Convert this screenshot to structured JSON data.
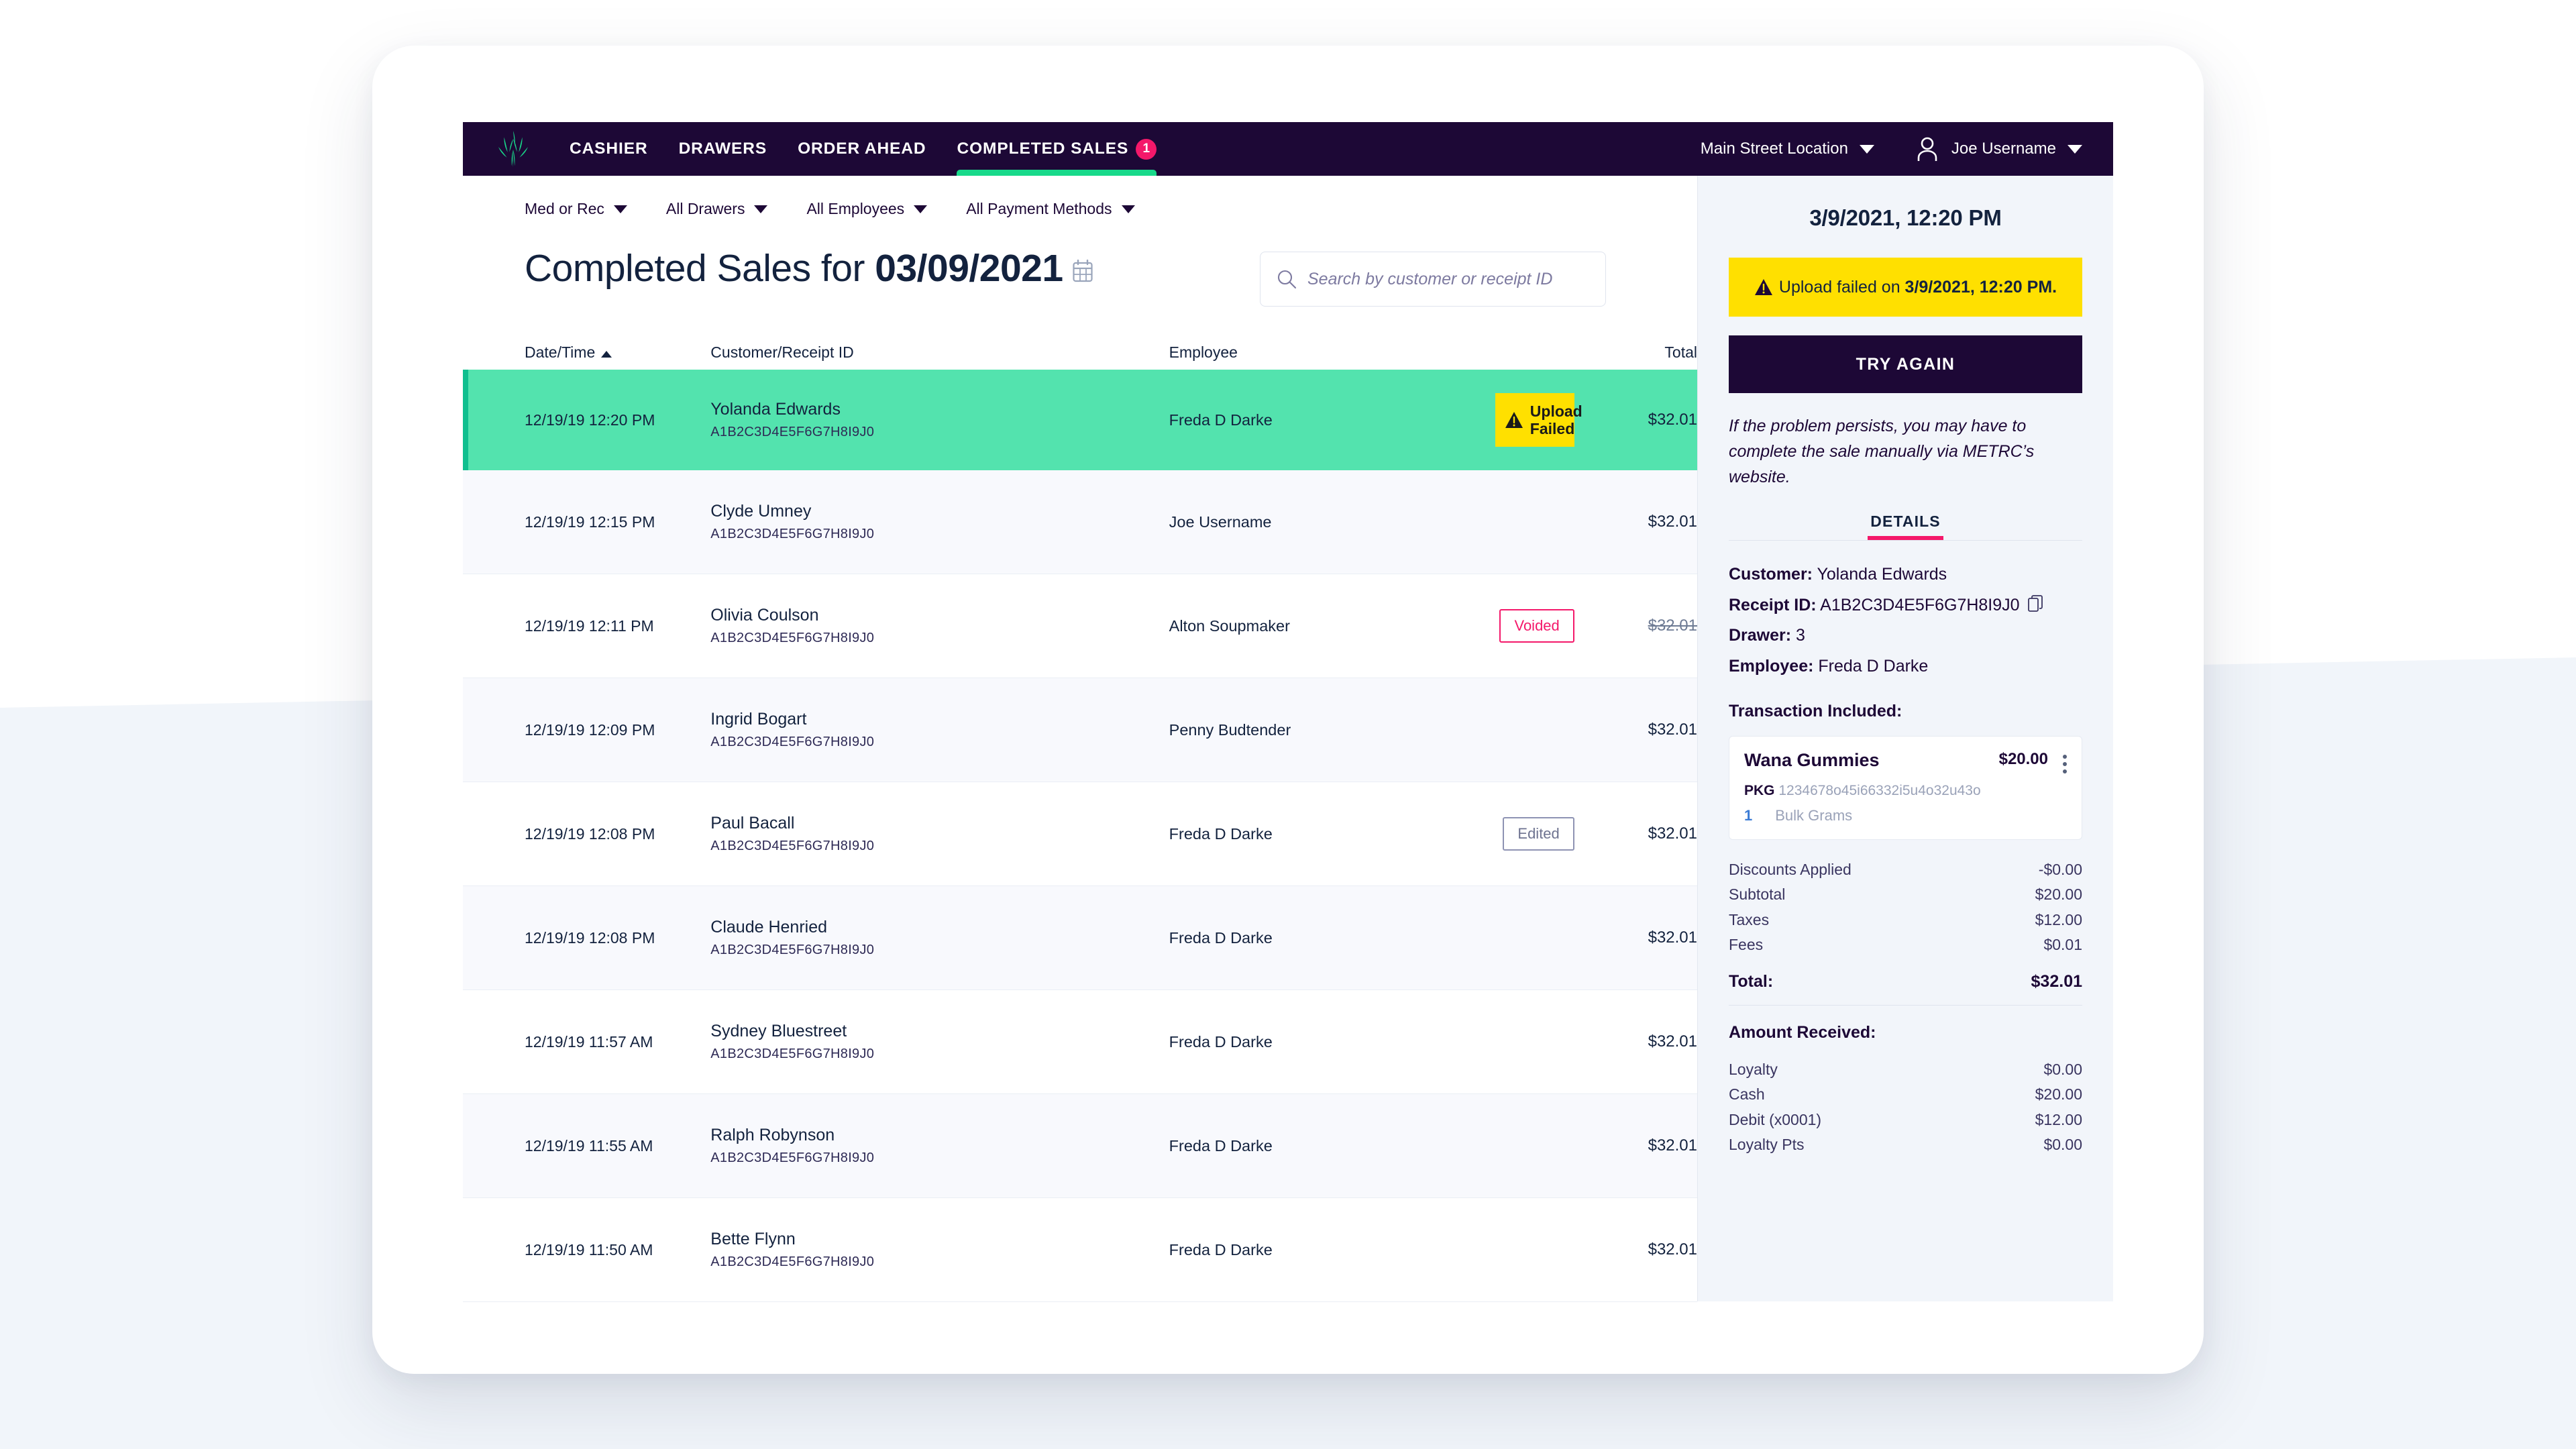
{
  "nav": {
    "logo_icon": "cannabis-leaf-icon",
    "links": [
      {
        "label": "CASHIER",
        "active": false
      },
      {
        "label": "DRAWERS",
        "active": false
      },
      {
        "label": "ORDER AHEAD",
        "active": false
      },
      {
        "label": "COMPLETED SALES",
        "active": true,
        "badge": "1"
      }
    ],
    "location": "Main Street Location",
    "user": "Joe Username"
  },
  "filters": [
    {
      "label": "Med or Rec"
    },
    {
      "label": "All Drawers"
    },
    {
      "label": "All Employees"
    },
    {
      "label": "All Payment Methods"
    }
  ],
  "header": {
    "title_prefix": "Completed Sales for ",
    "title_date": "03/09/2021",
    "calendar_icon": "calendar-icon"
  },
  "search": {
    "placeholder": "Search by customer or receipt ID",
    "value": "",
    "icon": "search-icon"
  },
  "table": {
    "columns": [
      "Date/Time",
      "Customer/Receipt ID",
      "Employee",
      "",
      "Total"
    ],
    "sort_column": "Date/Time",
    "sort_direction": "asc",
    "rows": [
      {
        "datetime": "12/19/19 12:20 PM",
        "customer": "Yolanda Edwards",
        "receipt_id": "A1B2C3D4E5F6G7H8I9J0",
        "employee": "Freda D Darke",
        "flag": "Upload Failed",
        "flag_type": "upload-failed",
        "total": "$32.01",
        "selected": true
      },
      {
        "datetime": "12/19/19 12:15 PM",
        "customer": "Clyde Umney",
        "receipt_id": "A1B2C3D4E5F6G7H8I9J0",
        "employee": "Joe Username",
        "flag": "",
        "flag_type": "",
        "total": "$32.01",
        "selected": false
      },
      {
        "datetime": "12/19/19 12:11 PM",
        "customer": "Olivia Coulson",
        "receipt_id": "A1B2C3D4E5F6G7H8I9J0",
        "employee": "Alton Soupmaker",
        "flag": "Voided",
        "flag_type": "voided",
        "total": "$32.01",
        "selected": false
      },
      {
        "datetime": "12/19/19 12:09 PM",
        "customer": "Ingrid Bogart",
        "receipt_id": "A1B2C3D4E5F6G7H8I9J0",
        "employee": "Penny Budtender",
        "flag": "",
        "flag_type": "",
        "total": "$32.01",
        "selected": false
      },
      {
        "datetime": "12/19/19 12:08 PM",
        "customer": "Paul Bacall",
        "receipt_id": "A1B2C3D4E5F6G7H8I9J0",
        "employee": "Freda D Darke",
        "flag": "Edited",
        "flag_type": "edited",
        "total": "$32.01",
        "selected": false
      },
      {
        "datetime": "12/19/19 12:08 PM",
        "customer": "Claude Henried",
        "receipt_id": "A1B2C3D4E5F6G7H8I9J0",
        "employee": "Freda D Darke",
        "flag": "",
        "flag_type": "",
        "total": "$32.01",
        "selected": false
      },
      {
        "datetime": "12/19/19 11:57 AM",
        "customer": "Sydney Bluestreet",
        "receipt_id": "A1B2C3D4E5F6G7H8I9J0",
        "employee": "Freda D Darke",
        "flag": "",
        "flag_type": "",
        "total": "$32.01",
        "selected": false
      },
      {
        "datetime": "12/19/19 11:55 AM",
        "customer": "Ralph Robynson",
        "receipt_id": "A1B2C3D4E5F6G7H8I9J0",
        "employee": "Freda D Darke",
        "flag": "",
        "flag_type": "",
        "total": "$32.01",
        "selected": false
      },
      {
        "datetime": "12/19/19 11:50 AM",
        "customer": "Bette Flynn",
        "receipt_id": "A1B2C3D4E5F6G7H8I9J0",
        "employee": "Freda D Darke",
        "flag": "",
        "flag_type": "",
        "total": "$32.01",
        "selected": false
      }
    ]
  },
  "detail": {
    "datetime": "3/9/2021, 12:20 PM",
    "alert_icon": "warning-triangle-icon",
    "alert_prefix": "Upload failed on ",
    "alert_date": "3/9/2021, 12:20 PM.",
    "try_again_label": "TRY AGAIN",
    "note": "If the problem persists, you may have to complete the sale manually via METRC’s website.",
    "tab_label": "DETAILS",
    "fields": [
      {
        "label": "Customer:",
        "value": "Yolanda Edwards",
        "copy": false
      },
      {
        "label": "Receipt ID:",
        "value": "A1B2C3D4E5F6G7H8I9J0",
        "copy": true
      },
      {
        "label": "Drawer:",
        "value": "3",
        "copy": false
      },
      {
        "label": "Employee:",
        "value": "Freda D Darke",
        "copy": false
      }
    ],
    "transaction_heading": "Transaction Included:",
    "item": {
      "name": "Wana Gummies",
      "price": "$20.00",
      "pkg_label": "PKG",
      "pkg_value": "1234678o45i66332i5u4o32u43o",
      "qty": "1",
      "unit": "Bulk Grams",
      "menu_icon": "kebab-menu-icon"
    },
    "totals": [
      {
        "label": "Discounts Applied",
        "value": "-$0.00"
      },
      {
        "label": "Subtotal",
        "value": "$20.00"
      },
      {
        "label": "Taxes",
        "value": "$12.00"
      },
      {
        "label": "Fees",
        "value": "$0.01"
      }
    ],
    "total_label": "Total:",
    "total_value": "$32.01",
    "received_heading": "Amount Received:",
    "received": [
      {
        "label": "Loyalty",
        "value": "$0.00"
      },
      {
        "label": "Cash",
        "value": "$20.00"
      },
      {
        "label": "Debit (x0001)",
        "value": "$12.00"
      },
      {
        "label": "Loyalty Pts",
        "value": "$0.00"
      }
    ]
  },
  "colors": {
    "nav_bg": "#1d0836",
    "accent_green": "#18d98a",
    "selected_row": "#53e3ae",
    "badge_pink": "#f4186a",
    "warning_yellow": "#ffe000",
    "text_dark": "#13223e"
  }
}
